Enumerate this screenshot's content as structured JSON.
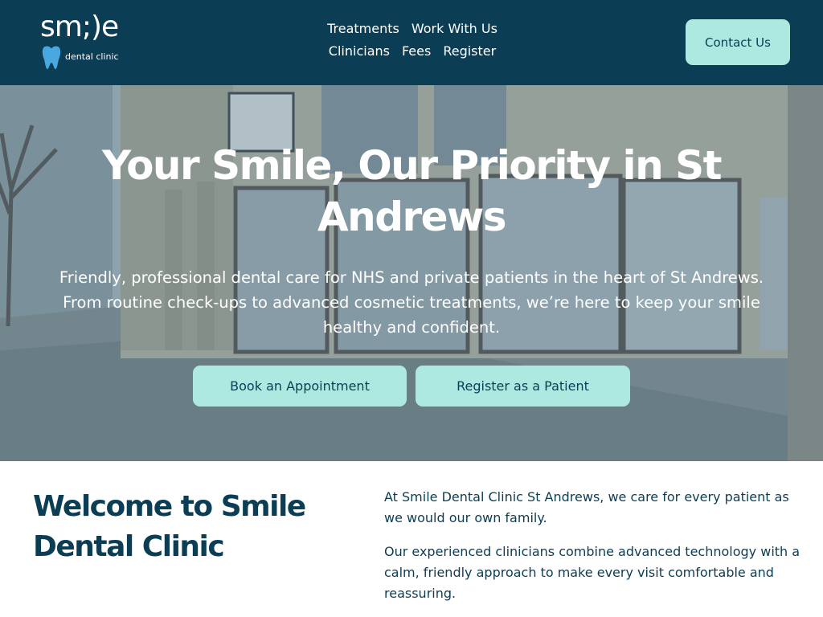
{
  "header": {
    "logo": {
      "word": "sm;)e",
      "subtitle": "dental clinic",
      "icon": "tooth-icon"
    },
    "nav": [
      "Treatments",
      "Work With Us",
      "Clinicians",
      "Fees",
      "Register"
    ],
    "contact_label": "Contact Us"
  },
  "hero": {
    "title": "Your Smile, Our Priority in St Andrews",
    "subtitle": "Friendly, professional dental care for NHS and private patients in the heart of St Andrews. From routine check-ups to advanced cosmetic treatments, we’re here to keep your smile healthy and confident.",
    "book_label": "Book an Appointment",
    "register_label": "Register as a Patient"
  },
  "welcome": {
    "title": "Welcome to Smile Dental Clinic",
    "paragraphs": [
      "At Smile Dental Clinic St Andrews, we care for every patient as we would our own family.",
      "Our experienced clinicians combine advanced technology with a calm, friendly approach to make every visit comfortable and reassuring."
    ]
  },
  "colors": {
    "brand_navy": "#0b3d55",
    "accent_mint": "#aee9e1",
    "tooth_blue": "#4aa8e0"
  }
}
